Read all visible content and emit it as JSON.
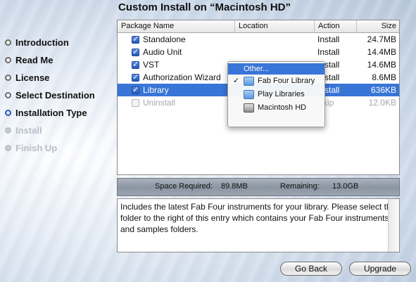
{
  "title": "Custom Install on “Macintosh HD”",
  "steps": [
    {
      "label": "Introduction",
      "state": "done"
    },
    {
      "label": "Read Me",
      "state": "done"
    },
    {
      "label": "License",
      "state": "done"
    },
    {
      "label": "Select Destination",
      "state": "done"
    },
    {
      "label": "Installation Type",
      "state": "active"
    },
    {
      "label": "Install",
      "state": "disabled"
    },
    {
      "label": "Finish Up",
      "state": "disabled"
    }
  ],
  "table": {
    "headers": {
      "name": "Package Name",
      "location": "Location",
      "action": "Action",
      "size": "Size"
    },
    "rows": [
      {
        "name": "Standalone",
        "location": "",
        "action": "Install",
        "size": "24.7MB",
        "checked": true
      },
      {
        "name": "Audio Unit",
        "location": "",
        "action": "Install",
        "size": "14.4MB",
        "checked": true
      },
      {
        "name": "VST",
        "location": "",
        "action": "Install",
        "size": "14.6MB",
        "checked": true
      },
      {
        "name": "Authorization Wizard",
        "location": "",
        "action": "Install",
        "size": "8.6MB",
        "checked": true
      },
      {
        "name": "Library",
        "location": "",
        "action": "Install",
        "size": "636KB",
        "checked": true,
        "selected": true
      },
      {
        "name": "Uninstall",
        "location": "",
        "action": "Skip",
        "size": "12.0KB",
        "checked": false,
        "disabled": true
      }
    ]
  },
  "location_menu": {
    "other": "Other...",
    "items": [
      {
        "label": "Fab Four Library",
        "checked": true,
        "icon": "folder-icon"
      },
      {
        "label": "Play Libraries",
        "checked": false,
        "icon": "folder-icon"
      },
      {
        "label": "Macintosh HD",
        "checked": false,
        "icon": "hard-disk-icon"
      }
    ],
    "check_glyph": "✓"
  },
  "space": {
    "required_label": "Space Required:",
    "required_value": "89.8MB",
    "remaining_label": "Remaining:",
    "remaining_value": "13.0GB"
  },
  "description": "Includes the latest Fab Four instruments for your library. Please select the folder to the right of this entry which contains your Fab Four instruments and samples folders.",
  "buttons": {
    "back": "Go Back",
    "next": "Upgrade"
  }
}
